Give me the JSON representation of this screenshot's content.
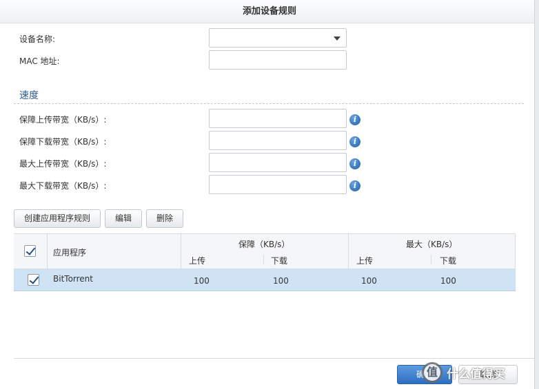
{
  "dialog": {
    "title": "添加设备规则"
  },
  "form": {
    "device_name_label": "设备名称:",
    "mac_label": "MAC 地址:",
    "mac_value": "",
    "device_name_value": ""
  },
  "speed": {
    "section_title": "速度",
    "fields": [
      {
        "label": "保障上传带宽（KB/s）:",
        "value": ""
      },
      {
        "label": "保障下载带宽（KB/s）:",
        "value": ""
      },
      {
        "label": "最大上传带宽（KB/s）:",
        "value": ""
      },
      {
        "label": "最大下载带宽（KB/s）:",
        "value": ""
      }
    ],
    "info_glyph": "i"
  },
  "toolbar": {
    "create_label": "创建应用程序规则",
    "edit_label": "编辑",
    "delete_label": "删除"
  },
  "grid": {
    "col_app": "应用程序",
    "col_guarantee": "保障（KB/s）",
    "col_max": "最大（KB/s）",
    "sub_up": "上传",
    "sub_down": "下载",
    "rows": [
      {
        "app": "BitTorrent",
        "g_up": "100",
        "g_down": "100",
        "m_up": "100",
        "m_down": "100",
        "checked": true
      }
    ]
  },
  "footer": {
    "ok_label": "确定",
    "cancel_label": "取消"
  },
  "watermark": {
    "logo_glyph": "值",
    "text": "什么值得买"
  },
  "colors": {
    "accent": "#2d6ec0",
    "selected_row": "#cfe3f4",
    "section_title": "#2f5c8f"
  }
}
